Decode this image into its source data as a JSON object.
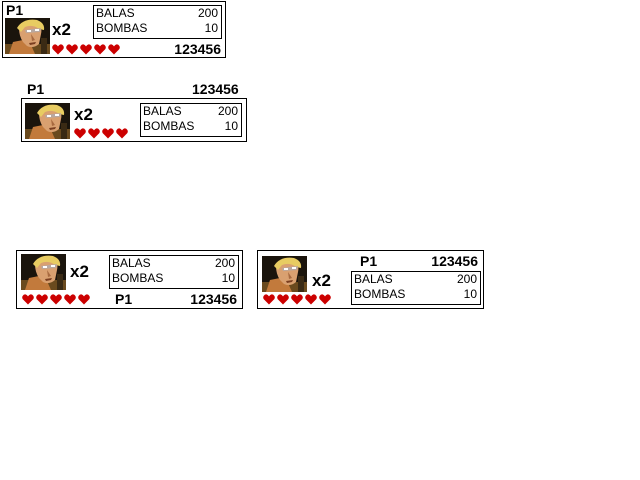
{
  "colors": {
    "heart": "#cc0000",
    "frame": "#000000",
    "background": "#ffffff"
  },
  "icons": {
    "portrait": "soldier-portrait-icon",
    "heart": "heart-icon"
  },
  "hud_variants": [
    {
      "player": "P1",
      "lives": "x2",
      "stats": [
        {
          "label": "BALAS",
          "value": "200"
        },
        {
          "label": "BOMBAS",
          "value": "10"
        }
      ],
      "hearts": 5,
      "score": "123456"
    },
    {
      "player": "P1",
      "lives": "x2",
      "stats": [
        {
          "label": "BALAS",
          "value": "200"
        },
        {
          "label": "BOMBAS",
          "value": "10"
        }
      ],
      "hearts": 4,
      "score": "123456"
    },
    {
      "player": "P1",
      "lives": "x2",
      "stats": [
        {
          "label": "BALAS",
          "value": "200"
        },
        {
          "label": "BOMBAS",
          "value": "10"
        }
      ],
      "hearts": 5,
      "score": "123456"
    },
    {
      "player": "P1",
      "lives": "x2",
      "stats": [
        {
          "label": "BALAS",
          "value": "200"
        },
        {
          "label": "BOMBAS",
          "value": "10"
        }
      ],
      "hearts": 5,
      "score": "123456"
    }
  ]
}
